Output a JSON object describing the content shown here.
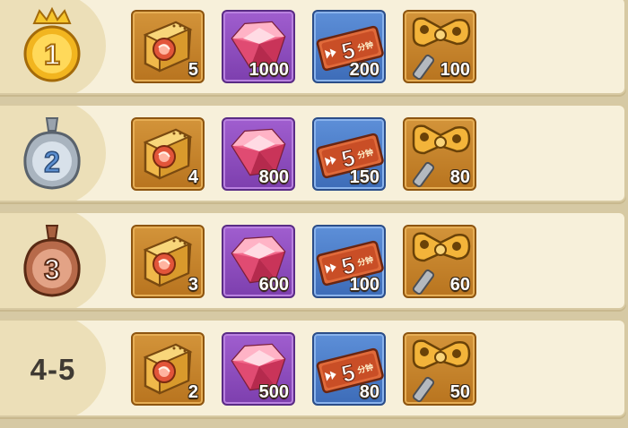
{
  "rows": [
    {
      "rank": "1",
      "badge_icon": "gold-crown-medal-icon",
      "badge_color": "#f2b51f",
      "items": [
        {
          "icon": "meat-ticket-icon",
          "qty": "5"
        },
        {
          "icon": "pink-gem-icon",
          "qty": "1000"
        },
        {
          "icon": "5-min-speedup-ticket-icon",
          "qty": "200"
        },
        {
          "icon": "windup-key-icon",
          "qty": "100"
        }
      ]
    },
    {
      "rank": "2",
      "badge_icon": "silver-medal-icon",
      "badge_color": "#a9b4bf",
      "items": [
        {
          "icon": "meat-ticket-icon",
          "qty": "4"
        },
        {
          "icon": "pink-gem-icon",
          "qty": "800"
        },
        {
          "icon": "5-min-speedup-ticket-icon",
          "qty": "150"
        },
        {
          "icon": "windup-key-icon",
          "qty": "80"
        }
      ]
    },
    {
      "rank": "3",
      "badge_icon": "bronze-medal-icon",
      "badge_color": "#b76a4a",
      "items": [
        {
          "icon": "meat-ticket-icon",
          "qty": "3"
        },
        {
          "icon": "pink-gem-icon",
          "qty": "600"
        },
        {
          "icon": "5-min-speedup-ticket-icon",
          "qty": "100"
        },
        {
          "icon": "windup-key-icon",
          "qty": "60"
        }
      ]
    },
    {
      "rank": "4-5",
      "badge_icon": "",
      "items": [
        {
          "icon": "meat-ticket-icon",
          "qty": "2"
        },
        {
          "icon": "pink-gem-icon",
          "qty": "500"
        },
        {
          "icon": "5-min-speedup-ticket-icon",
          "qty": "80"
        },
        {
          "icon": "windup-key-icon",
          "qty": "50"
        }
      ]
    }
  ],
  "ticket_label": "5",
  "ticket_sublabel": "分钟"
}
